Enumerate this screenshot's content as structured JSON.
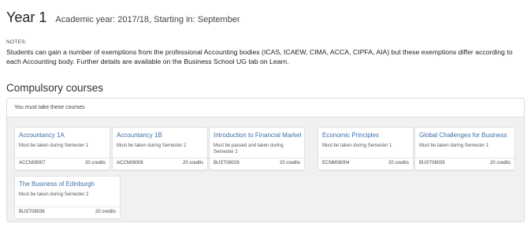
{
  "header": {
    "year": "Year 1",
    "subtitle": "Academic year: 2017/18, Starting in: September"
  },
  "notes": {
    "label": "NOTES:",
    "text": "Students can gain a number of exemptions from the professional Accounting bodies (ICAS, ICAEW, CIMA, ACCA, CIPFA, AIA) but these exemptions differ according to each Accounting body. Further details are available on the Business School UG tab on Learn."
  },
  "compulsory": {
    "title": "Compulsory courses",
    "panel_header": "You must take these courses",
    "courses": [
      {
        "title": "Accountancy 1A",
        "note": "Must be taken during Semester 1",
        "code": "ACCN08007",
        "credits": "20 credits"
      },
      {
        "title": "Accountancy 1B",
        "note": "Must be taken during Semester 2",
        "code": "ACCN08008",
        "credits": "20 credits"
      },
      {
        "title": "Introduction to Financial Markets",
        "note": "Must be passed and taken during Semester 2",
        "code": "BUST08029",
        "credits": "20 credits"
      },
      {
        "title": "Economic Principles",
        "note": "Must be taken during Semester 1",
        "code": "ECNM08004",
        "credits": "20 credits"
      },
      {
        "title": "Global Challenges for Business",
        "note": "Must be taken during Semester 1",
        "code": "BUST08035",
        "credits": "20 credits"
      },
      {
        "title": "The Business of Edinburgh",
        "note": "Must be taken during Semester 2",
        "code": "BUST08036",
        "credits": "20 credits"
      }
    ]
  },
  "colors": {
    "link": "#3f6fa8",
    "panel_bg": "#f1f1f1",
    "border": "#dcdcdc"
  }
}
